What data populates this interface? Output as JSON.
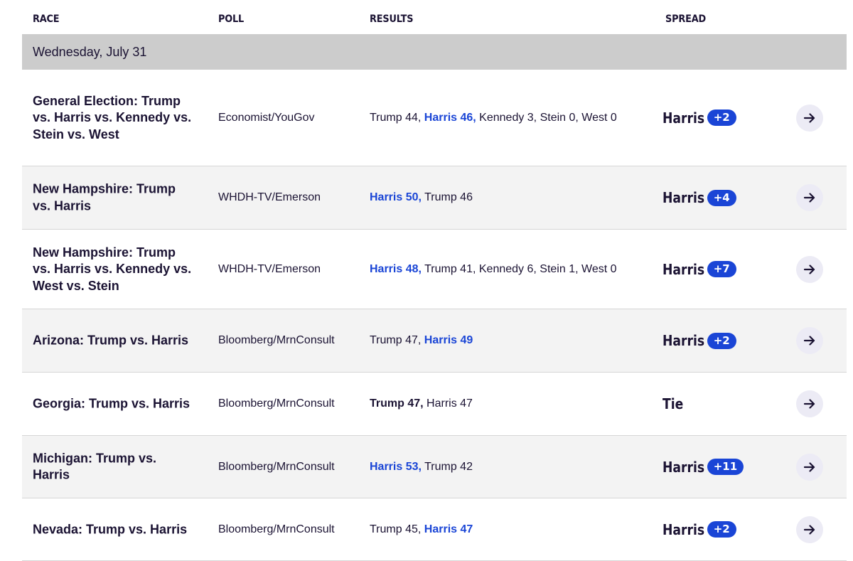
{
  "columns": {
    "race": "RACE",
    "poll": "POLL",
    "results": "RESULTS",
    "spread": "SPREAD"
  },
  "date": "Wednesday, July 31",
  "colors": {
    "accent": "#1a45d6",
    "text": "#1b1333",
    "date_bar": "#cccccc",
    "alt_row": "#f3f3f3"
  },
  "icons": {
    "row_action": "arrow-right-icon"
  },
  "rows": [
    {
      "race": "General Election: Trump vs. Harris vs. Kennedy vs. Stein vs. West",
      "poll": "Economist/YouGov",
      "results": [
        {
          "text": "Trump 44,",
          "style": "normal"
        },
        {
          "text": "Harris 46,",
          "style": "win"
        },
        {
          "text": "Kennedy 3,",
          "style": "normal"
        },
        {
          "text": "Stein 0,",
          "style": "normal"
        },
        {
          "text": "West 0",
          "style": "normal"
        }
      ],
      "spread_name": "Harris",
      "spread_value": "+2"
    },
    {
      "race": "New Hampshire: Trump vs. Harris",
      "poll": "WHDH-TV/Emerson",
      "results": [
        {
          "text": "Harris 50,",
          "style": "win"
        },
        {
          "text": "Trump 46",
          "style": "normal"
        }
      ],
      "spread_name": "Harris",
      "spread_value": "+4"
    },
    {
      "race": "New Hampshire: Trump vs. Harris vs. Kennedy vs. West vs. Stein",
      "poll": "WHDH-TV/Emerson",
      "results": [
        {
          "text": "Harris 48,",
          "style": "win"
        },
        {
          "text": "Trump 41,",
          "style": "normal"
        },
        {
          "text": "Kennedy 6,",
          "style": "normal"
        },
        {
          "text": "Stein 1,",
          "style": "normal"
        },
        {
          "text": "West 0",
          "style": "normal"
        }
      ],
      "spread_name": "Harris",
      "spread_value": "+7"
    },
    {
      "race": "Arizona: Trump vs. Harris",
      "poll": "Bloomberg/MrnConsult",
      "results": [
        {
          "text": "Trump 47,",
          "style": "normal"
        },
        {
          "text": "Harris 49",
          "style": "win"
        }
      ],
      "spread_name": "Harris",
      "spread_value": "+2"
    },
    {
      "race": "Georgia: Trump vs. Harris",
      "poll": "Bloomberg/MrnConsult",
      "results": [
        {
          "text": "Trump 47,",
          "style": "lead"
        },
        {
          "text": "Harris 47",
          "style": "normal"
        }
      ],
      "spread_name": "Tie",
      "spread_value": ""
    },
    {
      "race": "Michigan: Trump vs. Harris",
      "poll": "Bloomberg/MrnConsult",
      "results": [
        {
          "text": "Harris 53,",
          "style": "win"
        },
        {
          "text": "Trump 42",
          "style": "normal"
        }
      ],
      "spread_name": "Harris",
      "spread_value": "+11"
    },
    {
      "race": "Nevada: Trump vs. Harris",
      "poll": "Bloomberg/MrnConsult",
      "results": [
        {
          "text": "Trump 45,",
          "style": "normal"
        },
        {
          "text": "Harris 47",
          "style": "win"
        }
      ],
      "spread_name": "Harris",
      "spread_value": "+2"
    }
  ]
}
